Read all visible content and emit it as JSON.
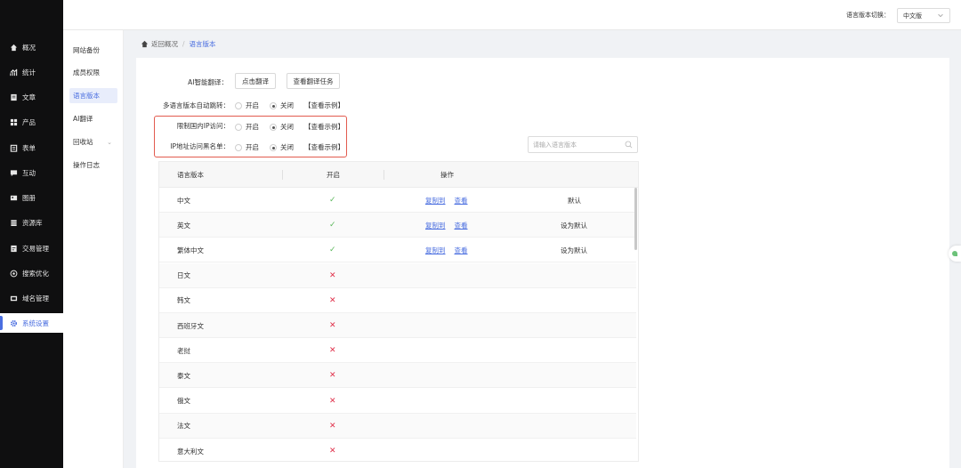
{
  "header": {
    "lang_switch_label": "语言版本切换：",
    "lang_select_value": "中文版"
  },
  "sidebar": {
    "items": [
      {
        "label": "概况",
        "icon": "home-icon"
      },
      {
        "label": "统计",
        "icon": "chart-icon"
      },
      {
        "label": "文章",
        "icon": "document-icon"
      },
      {
        "label": "产品",
        "icon": "grid-icon"
      },
      {
        "label": "表单",
        "icon": "form-icon"
      },
      {
        "label": "互动",
        "icon": "chat-icon"
      },
      {
        "label": "图册",
        "icon": "album-icon"
      },
      {
        "label": "资源库",
        "icon": "database-icon"
      },
      {
        "label": "交易管理",
        "icon": "trade-icon"
      },
      {
        "label": "搜索优化",
        "icon": "seo-icon"
      },
      {
        "label": "域名管理",
        "icon": "domain-icon"
      },
      {
        "label": "系统设置",
        "icon": "gear-icon",
        "active": true
      }
    ]
  },
  "submenu": {
    "items": [
      {
        "label": "网站备份"
      },
      {
        "label": "成员权限"
      },
      {
        "label": "语言版本",
        "active": true
      },
      {
        "label": "AI翻译"
      },
      {
        "label": "回收站",
        "has_arrow": true
      },
      {
        "label": "操作日志"
      }
    ]
  },
  "breadcrumb": {
    "back": "返回概况",
    "separator": "/",
    "current": "语言版本"
  },
  "settings": {
    "ai_translate_label": "AI智能翻译：",
    "ai_translate_button": "点击翻译",
    "view_tasks_button": "查看翻译任务",
    "auto_redirect_label": "多语言版本自动跳转：",
    "restrict_ip_label": "限制国内IP访问：",
    "ip_blacklist_label": "IP地址访问黑名单：",
    "opt_on": "开启",
    "opt_off": "关闭",
    "example_link": "【查看示例】"
  },
  "search": {
    "placeholder": "请输入语言版本"
  },
  "table": {
    "columns": [
      "语言版本",
      "开启",
      "操作"
    ],
    "copy_label": "复制到",
    "view_label": "查看",
    "rows": [
      {
        "name": "中文",
        "enabled": true,
        "ops": true,
        "status": "默认"
      },
      {
        "name": "英文",
        "enabled": true,
        "ops": true,
        "status": "设为默认"
      },
      {
        "name": "繁体中文",
        "enabled": true,
        "ops": true,
        "status": "设为默认"
      },
      {
        "name": "日文",
        "enabled": false,
        "ops": false,
        "status": ""
      },
      {
        "name": "韩文",
        "enabled": false,
        "ops": false,
        "status": ""
      },
      {
        "name": "西班牙文",
        "enabled": false,
        "ops": false,
        "status": ""
      },
      {
        "name": "老挝",
        "enabled": false,
        "ops": false,
        "status": ""
      },
      {
        "name": "泰文",
        "enabled": false,
        "ops": false,
        "status": ""
      },
      {
        "name": "俄文",
        "enabled": false,
        "ops": false,
        "status": ""
      },
      {
        "name": "法文",
        "enabled": false,
        "ops": false,
        "status": ""
      },
      {
        "name": "意大利文",
        "enabled": false,
        "ops": false,
        "status": ""
      }
    ]
  },
  "colors": {
    "accent": "#4a6ee0",
    "highlight_border": "#e25b4f",
    "check": "#5cb85c",
    "cross": "#e0304a",
    "sidebar_bg": "#0f0f10"
  }
}
